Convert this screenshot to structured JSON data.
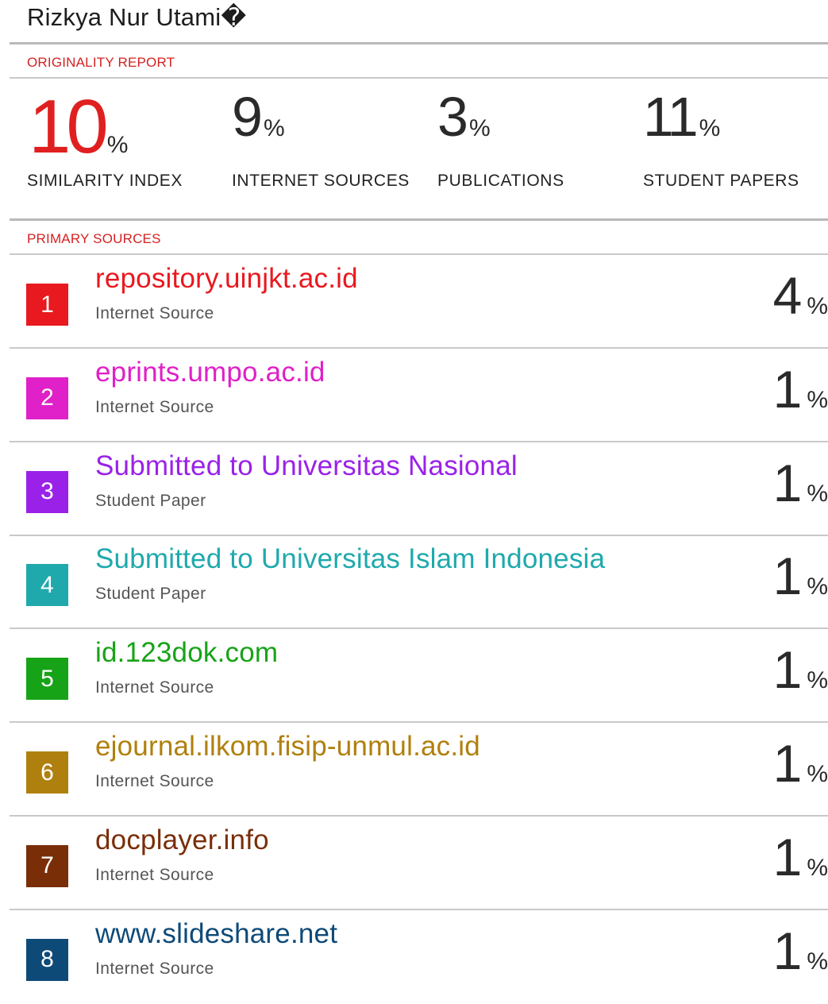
{
  "title": "Rizkya Nur Utami�",
  "report": {
    "originality_label": "ORIGINALITY REPORT",
    "primary_label": "PRIMARY SOURCES",
    "percent_sign": "%"
  },
  "stats": [
    {
      "value": "10",
      "label": "SIMILARITY INDEX"
    },
    {
      "value": "9",
      "label": "INTERNET SOURCES"
    },
    {
      "value": "3",
      "label": "PUBLICATIONS"
    },
    {
      "value": "11",
      "label": "STUDENT PAPERS"
    }
  ],
  "sources": [
    {
      "rank": "1",
      "name": "repository.uinjkt.ac.id",
      "type": "Internet Source",
      "share": "4",
      "color": "#e8191f"
    },
    {
      "rank": "2",
      "name": "eprints.umpo.ac.id",
      "type": "Internet Source",
      "share": "1",
      "color": "#e020c8"
    },
    {
      "rank": "3",
      "name": "Submitted to Universitas Nasional",
      "type": "Student Paper",
      "share": "1",
      "color": "#9a22e8"
    },
    {
      "rank": "4",
      "name": "Submitted to Universitas Islam Indonesia",
      "type": "Student Paper",
      "share": "1",
      "color": "#1fa9ad"
    },
    {
      "rank": "5",
      "name": "id.123dok.com",
      "type": "Internet Source",
      "share": "1",
      "color": "#17a317"
    },
    {
      "rank": "6",
      "name": "ejournal.ilkom.fisip-unmul.ac.id",
      "type": "Internet Source",
      "share": "1",
      "color": "#b0800e"
    },
    {
      "rank": "7",
      "name": "docplayer.info",
      "type": "Internet Source",
      "share": "1",
      "color": "#7a2e08"
    },
    {
      "rank": "8",
      "name": "www.slideshare.net",
      "type": "Internet Source",
      "share": "1",
      "color": "#0e4a78"
    }
  ]
}
